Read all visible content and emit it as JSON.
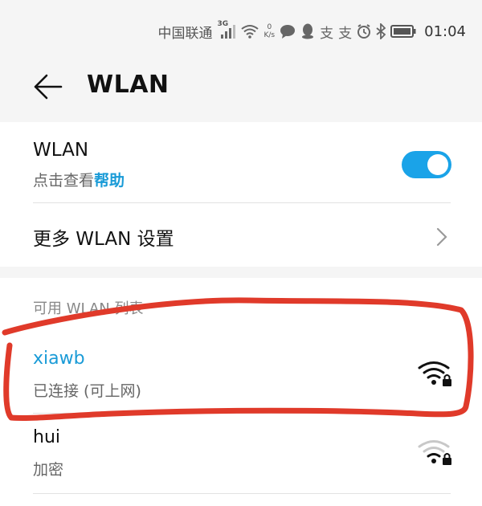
{
  "status_bar": {
    "carrier": "中国联通",
    "network_type": "3G",
    "speed_value": "0",
    "speed_unit": "K/s",
    "time": "01:04",
    "icons": [
      "signal-icon",
      "wifi-icon",
      "chat-icon",
      "qq-icon",
      "alipay-icon",
      "alipay-icon",
      "alarm-icon",
      "bluetooth-icon",
      "battery-icon"
    ]
  },
  "header": {
    "back_icon": "arrow-left-icon",
    "title": "WLAN"
  },
  "wlan_toggle": {
    "title": "WLAN",
    "subtitle_prefix": "点击查看",
    "subtitle_link": "帮助",
    "enabled": true,
    "accent_color": "#1aa3e8"
  },
  "more_settings": {
    "label": "更多 WLAN 设置"
  },
  "available_list": {
    "label": "可用 WLAN 列表",
    "networks": [
      {
        "name": "xiawb",
        "status": "已连接 (可上网)",
        "connected": true,
        "secured": true,
        "name_color": "#1a9bd7"
      },
      {
        "name": "hui",
        "status": "加密",
        "connected": false,
        "secured": true,
        "name_color": "#111111"
      }
    ]
  },
  "annotation": {
    "color": "#e03a2a",
    "shape": "hand-drawn loop around connected network"
  }
}
